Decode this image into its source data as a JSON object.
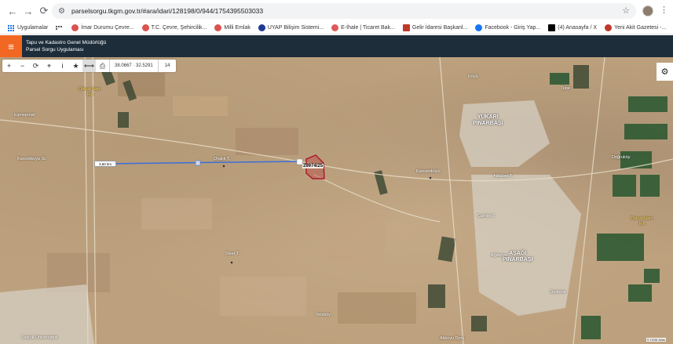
{
  "browser": {
    "url": "parselsorgu.tkgm.gov.tr/#ara/idari/128198/0/944/1754395503033",
    "bookmarks": [
      {
        "label": "Uygulamalar",
        "color": "#1a73e8"
      },
      {
        "label": "İmar Durumu Çevre...",
        "color": "#d9534f"
      },
      {
        "label": "T.C. Çevre, Şehircilik...",
        "color": "#d9534f"
      },
      {
        "label": "Milli Emlak",
        "color": "#d9534f"
      },
      {
        "label": "UYAP Bilişim Sistemi...",
        "color": "#1f3a93"
      },
      {
        "label": "E-İhale | Ticaret Bak...",
        "color": "#e05a5a"
      },
      {
        "label": "Gelir İdaresi Başkanl...",
        "color": "#c0392b"
      },
      {
        "label": "Facebook - Giriş Yap...",
        "color": "#1877f2"
      },
      {
        "label": "(4) Anasayfa / X",
        "color": "#000000"
      },
      {
        "label": "Yeni Akit Gazetesi -...",
        "color": "#c0392b"
      }
    ],
    "more": "»"
  },
  "header": {
    "line1": "Tapu ve Kadastro Genel Müdürlüğü",
    "line2": "Parsel Sorgu Uygulaması",
    "accent": "#f26722",
    "bg": "#1d2d3a"
  },
  "toolbar": {
    "coords": "38.0667 · 32.5291",
    "zoom": "14"
  },
  "map": {
    "measurement": "3,50 km",
    "parcel": "29974/25",
    "labels": {
      "dokuz_hani": "Dokuz Hanı\nHill",
      "esmepinar": "Eşmepınar",
      "karcebkoyu": "Karcebkoyu Sr.",
      "ovalik": "Ovalık T.",
      "karcamkoyu": "Karcamköyü",
      "yukari": "YUKARI\nPINARBAŞI",
      "asagi": "AŞAĞI\nPINARBAŞI",
      "siver": "Siver T.",
      "yenikoy": "Yeniköy",
      "akalan": "Akkalan T.",
      "koyu": "Köyü",
      "agilkoyu": "Ağılkoyu",
      "camlik": "Çamlık T.",
      "tepe": "Tepe",
      "kuzey_hani": "Dokuz Hanı\nHill",
      "selcuk": "Selçuk Üniversitesi",
      "koyu_alt": "Akkoyu Doru",
      "dogrukoy": "Doğruköy",
      "ozdemir": "Özdemir"
    },
    "attribution": "© HGM Atlas"
  }
}
